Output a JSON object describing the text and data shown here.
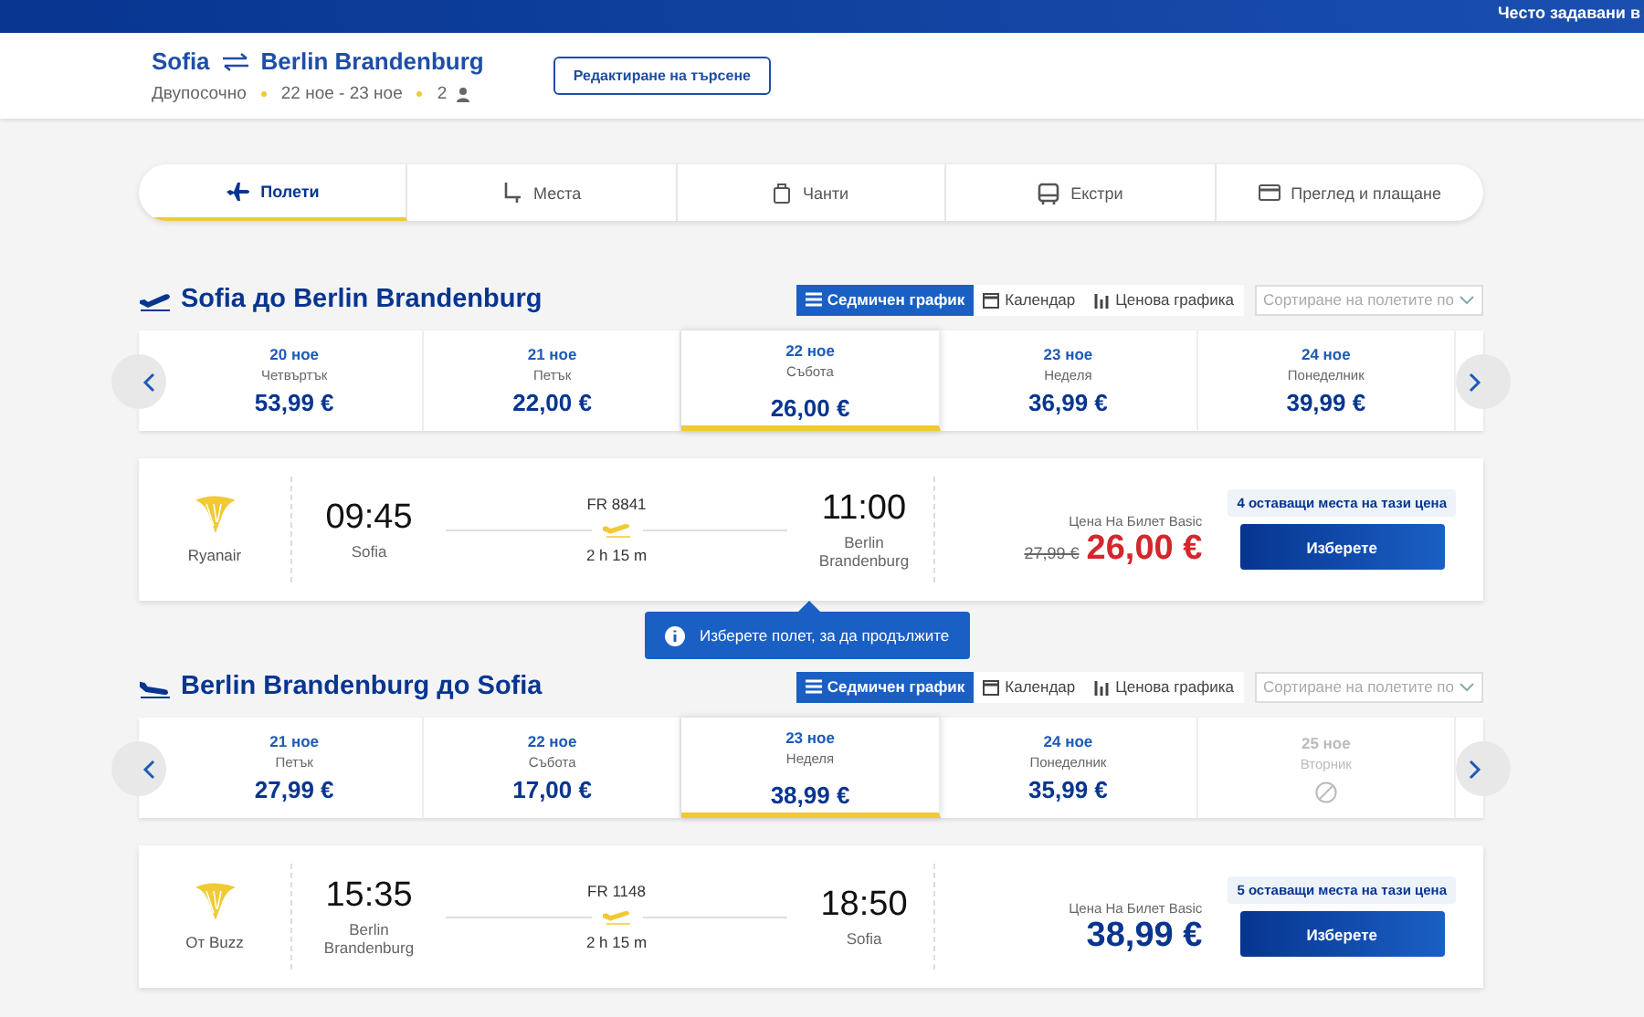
{
  "top_bar": {
    "link": "Често задавани в"
  },
  "trip": {
    "origin": "Sofia",
    "destination": "Berlin Brandenburg",
    "type": "Двупосочно",
    "dates": "22 ное - 23 ное",
    "passengers": "2",
    "edit_button": "Редактиране на търсене"
  },
  "steps": [
    {
      "label": "Полети",
      "selected": true,
      "kind": "plane"
    },
    {
      "label": "Места",
      "selected": false,
      "kind": "seat"
    },
    {
      "label": "Чанти",
      "selected": false,
      "kind": "bag"
    },
    {
      "label": "Екстри",
      "selected": false,
      "kind": "extras"
    },
    {
      "label": "Преглед и плащане",
      "selected": false,
      "kind": "card"
    }
  ],
  "tooltip": "Изберете полет, за да продължите",
  "legs": [
    {
      "title": "Sofia до Berlin Brandenburg",
      "kind": "outbound",
      "view_tabs": [
        {
          "label": "Седмичен график",
          "selected": true,
          "kind": "list"
        },
        {
          "label": "Календар",
          "selected": false,
          "kind": "calendar"
        },
        {
          "label": "Ценова графика",
          "selected": false,
          "kind": "chart"
        }
      ],
      "sort_placeholder": "Сортиране на полетите по",
      "days": [
        {
          "date": "20 ное",
          "weekday": "Четвъртък",
          "price": "53,99 €",
          "selected": false,
          "available": true
        },
        {
          "date": "21 ное",
          "weekday": "Петък",
          "price": "22,00 €",
          "selected": false,
          "available": true
        },
        {
          "date": "22 ное",
          "weekday": "Събота",
          "price": "26,00 €",
          "selected": true,
          "available": true
        },
        {
          "date": "23 ное",
          "weekday": "Неделя",
          "price": "36,99 €",
          "selected": false,
          "available": true
        },
        {
          "date": "24 ное",
          "weekday": "Понеделник",
          "price": "39,99 €",
          "selected": false,
          "available": true
        }
      ],
      "flight": {
        "airline": "Ryanair",
        "depart_time": "09:45",
        "depart_city": "Sofia",
        "flight_number": "FR 8841",
        "duration": "2 h 15 m",
        "arrive_time": "11:00",
        "arrive_city": "Berlin Brandenburg",
        "fare_label": "Цена На Билет Basic",
        "seats_left": "4 оставащи места на тази цена",
        "old_price": "27,99 €",
        "price": "26,00 €",
        "discounted": true,
        "select_button": "Изберете"
      }
    },
    {
      "title": "Berlin Brandenburg до Sofia",
      "kind": "return",
      "view_tabs": [
        {
          "label": "Седмичен график",
          "selected": true,
          "kind": "list"
        },
        {
          "label": "Календар",
          "selected": false,
          "kind": "calendar"
        },
        {
          "label": "Ценова графика",
          "selected": false,
          "kind": "chart"
        }
      ],
      "sort_placeholder": "Сортиране на полетите по",
      "days": [
        {
          "date": "21 ное",
          "weekday": "Петък",
          "price": "27,99 €",
          "selected": false,
          "available": true
        },
        {
          "date": "22 ное",
          "weekday": "Събота",
          "price": "17,00 €",
          "selected": false,
          "available": true
        },
        {
          "date": "23 ное",
          "weekday": "Неделя",
          "price": "38,99 €",
          "selected": true,
          "available": true
        },
        {
          "date": "24 ное",
          "weekday": "Понеделник",
          "price": "35,99 €",
          "selected": false,
          "available": true
        },
        {
          "date": "25 ное",
          "weekday": "Вторник",
          "selected": false,
          "available": false
        }
      ],
      "flight": {
        "airline": "От Buzz",
        "depart_time": "15:35",
        "depart_city": "Berlin Brandenburg",
        "flight_number": "FR 1148",
        "duration": "2 h 15 m",
        "arrive_time": "18:50",
        "arrive_city": "Sofia",
        "fare_label": "Цена На Билет Basic",
        "seats_left": "5 оставащи места на тази цена",
        "price": "38,99 €",
        "discounted": false,
        "select_button": "Изберете"
      }
    }
  ]
}
